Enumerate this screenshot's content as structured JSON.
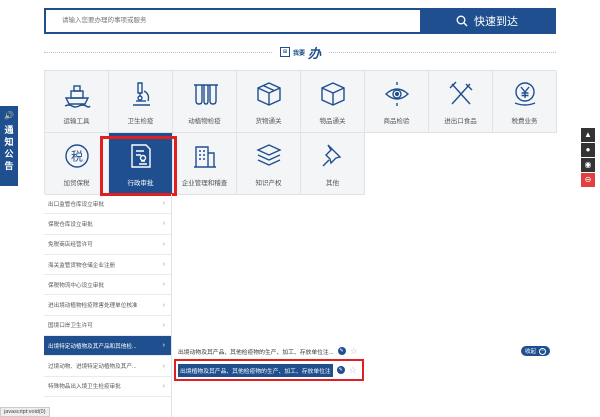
{
  "search": {
    "placeholder": "请输入您要办理的事项或服务",
    "button_label": "快速到达"
  },
  "banner": {
    "prefix": "我要",
    "mark": "办"
  },
  "grid_items": [
    {
      "label": "运输工具",
      "icon": "ship-icon"
    },
    {
      "label": "卫生检疫",
      "icon": "microscope-icon"
    },
    {
      "label": "动植物检疫",
      "icon": "test-tubes-icon"
    },
    {
      "label": "货物通关",
      "icon": "box-icon"
    },
    {
      "label": "物品通关",
      "icon": "cube-icon"
    },
    {
      "label": "商品检验",
      "icon": "eye-target-icon"
    },
    {
      "label": "进出口食品",
      "icon": "fork-knife-icon"
    },
    {
      "label": "税费业务",
      "icon": "yen-icon"
    },
    {
      "label": "加贸保税",
      "icon": "tax-icon"
    },
    {
      "label": "行政审批",
      "icon": "document-stamp-icon"
    },
    {
      "label": "企业管理和稽查",
      "icon": "building-icon"
    },
    {
      "label": "知识产权",
      "icon": "stack-icon"
    },
    {
      "label": "其他",
      "icon": "pin-icon"
    }
  ],
  "list_items": [
    "出口监管仓库设立审批",
    "保税仓库设立审批",
    "免税商店经营许可",
    "海关监管货物仓储企业注册",
    "保税物流中心设立审批",
    "进出境动植物检疫除害处理单位核准",
    "国境口岸卫生许可",
    "出境特定动植物及其产品和其他检...",
    "过境动物、进境特定动植物及其产...",
    "特殊物品出入境卫生检疫审批"
  ],
  "detail_rows": [
    {
      "text": "出境动物及其产品、其他检疫物的生产、加工、存放单位注..."
    },
    {
      "text": "出境植物及其产品、其他检疫物的生产、加工、存放单位注"
    }
  ],
  "collapse_label": "收起",
  "notice_label": [
    "通",
    "知",
    "公",
    "告"
  ],
  "right_icons": [
    "android-icon",
    "apple-icon",
    "wechat-icon",
    "collapse-icon"
  ],
  "status_text": "javascript:void(0)",
  "colors": {
    "brand": "#1f4f8f",
    "highlight_border": "#e02020",
    "cell_bg": "#f4f5f7"
  }
}
